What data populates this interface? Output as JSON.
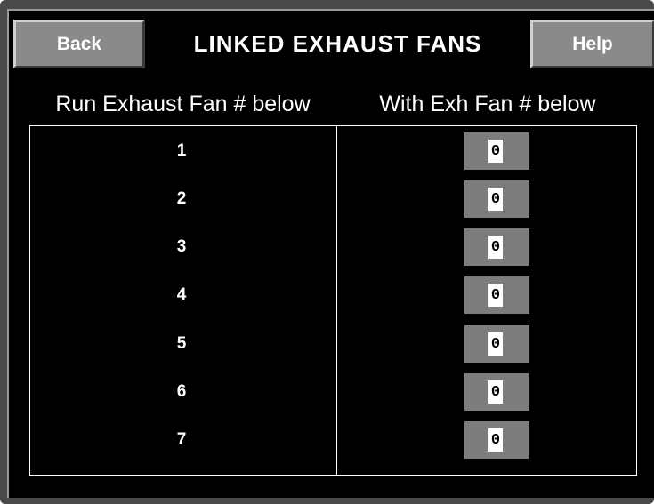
{
  "header": {
    "back_label": "Back",
    "title": "LINKED EXHAUST FANS",
    "help_label": "Help"
  },
  "columns": {
    "left": "Run Exhaust Fan # below",
    "right": "With Exh Fan # below"
  },
  "rows": [
    {
      "fan": "1",
      "linked_to": "0"
    },
    {
      "fan": "2",
      "linked_to": "0"
    },
    {
      "fan": "3",
      "linked_to": "0"
    },
    {
      "fan": "4",
      "linked_to": "0"
    },
    {
      "fan": "5",
      "linked_to": "0"
    },
    {
      "fan": "6",
      "linked_to": "0"
    },
    {
      "fan": "7",
      "linked_to": "0"
    }
  ],
  "colors": {
    "background": "#000000",
    "button": "#8a8a8a",
    "field": "#7d7d7d",
    "text": "#ffffff"
  }
}
